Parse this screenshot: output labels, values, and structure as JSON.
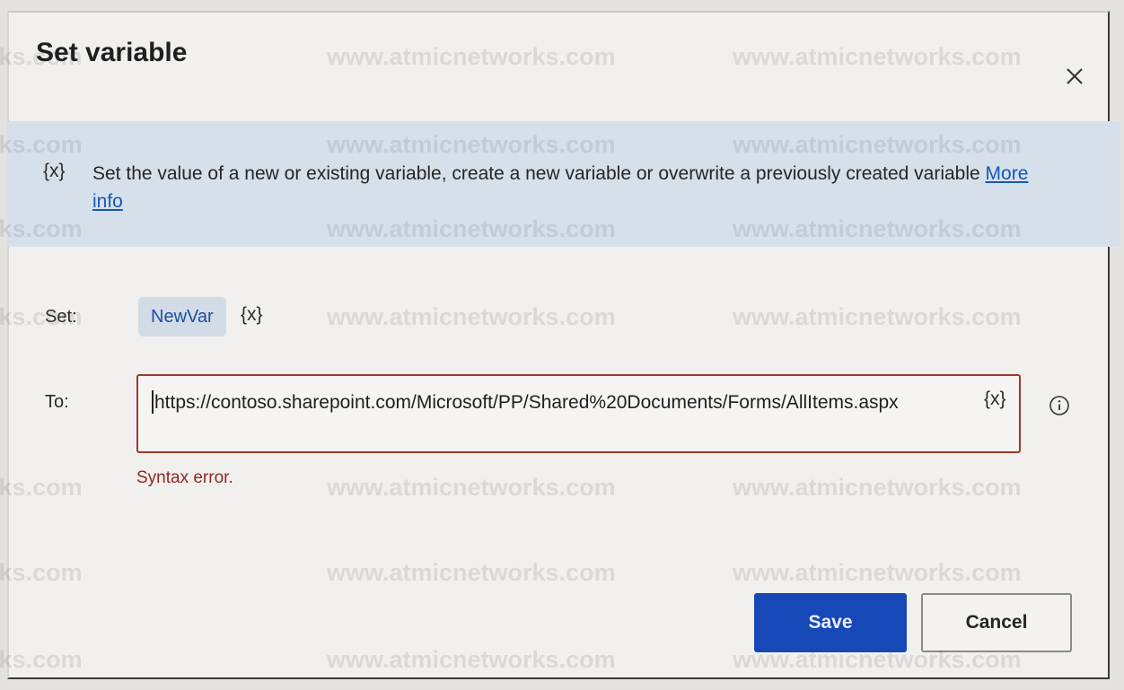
{
  "dialog": {
    "title": "Set variable",
    "close_glyph": "✕",
    "banner": {
      "icon": "{x}",
      "text": "Set the value of a new or existing variable, create a new variable or overwrite a previously created variable",
      "link_text": "More info"
    },
    "set_field": {
      "label": "Set:",
      "variable_name": "NewVar",
      "token": "{x}"
    },
    "to_field": {
      "label": "To:",
      "value": "https://contoso.sharepoint.com/Microsoft/PP/Shared%20Documents/Forms/AllItems.aspx",
      "token": "{x}",
      "info_icon": "info-icon"
    },
    "error_message": "Syntax error.",
    "buttons": {
      "save": "Save",
      "cancel": "Cancel"
    },
    "colors": {
      "primary": "#1748b8",
      "error": "#8c2a22",
      "banner_bg": "#d6e0ea",
      "link": "#1757b3"
    }
  },
  "watermarks": [
    "www.atmicnetworks.com",
    "www.atmicnetworks.com",
    "www.atmicnetworks.com",
    "www.atmicnetworks.com",
    "www.atmicnetworks.com",
    "www.atmicnetworks.com",
    "www.atmicnetworks.com",
    "www.atmicnetworks.com",
    "www.atmicnetworks.com",
    "www.atmicnetworks.com",
    "www.atmicnetworks.com",
    "www.atmicnetworks.com",
    "www.atmicnetworks.com",
    "www.atmicnetworks.com",
    "www.atmicnetworks.com",
    "www.atmicnetworks.com",
    "www.atmicnetworks.com",
    "www.atmicnetworks.com",
    "www.atmicnetworks.com",
    "www.atmicnetworks.com",
    "www.atmicnetworks.com"
  ]
}
